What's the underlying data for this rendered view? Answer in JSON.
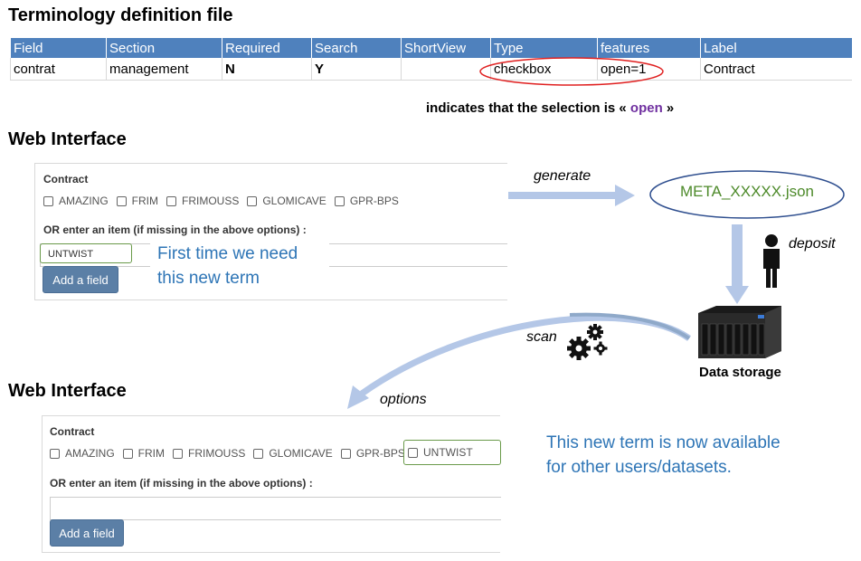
{
  "title_terminology": "Terminology definition file",
  "table": {
    "headers": [
      "Field",
      "Section",
      "Required",
      "Search",
      "ShortView",
      "Type",
      "features",
      "Label"
    ],
    "row": [
      "contrat",
      "management",
      "N",
      "Y",
      "",
      "checkbox",
      "open=1",
      "Contract"
    ]
  },
  "note": {
    "prefix": "indicates that the selection is « ",
    "word": "open",
    "suffix": " »"
  },
  "web1": {
    "title": "Web Interface",
    "contract_label": "Contract",
    "options": [
      "AMAZING",
      "FRIM",
      "FRIMOUSS",
      "GLOMICAVE",
      "GPR-BPS"
    ],
    "or_label": "OR enter an item (if missing in the above options) :",
    "input_value": "UNTWIST",
    "button": "Add a field",
    "callout_line1": "First time we need",
    "callout_line2": "this new term"
  },
  "flow": {
    "generate": "generate",
    "json_file": "META_XXXXX.json",
    "deposit": "deposit",
    "storage": "Data storage",
    "scan": "scan",
    "options": "options"
  },
  "web2": {
    "title": "Web Interface",
    "contract_label": "Contract",
    "options": [
      "AMAZING",
      "FRIM",
      "FRIMOUSS",
      "GLOMICAVE",
      "GPR-BPS",
      "UNTWIST"
    ],
    "or_label": "OR enter an item (if missing in the above options) :",
    "button": "Add a field"
  },
  "available_line1": "This new term is now available",
  "available_line2": "for other users/datasets.",
  "colors": {
    "table_header": "#4f81bd",
    "highlight_red": "#e02020",
    "callout_blue": "#2e75b6",
    "json_green": "#4d8a2a",
    "open_purple": "#7030a0",
    "button": "#5b7fa6"
  },
  "icons": [
    "person-icon",
    "gears-icon",
    "nas-server-icon"
  ]
}
